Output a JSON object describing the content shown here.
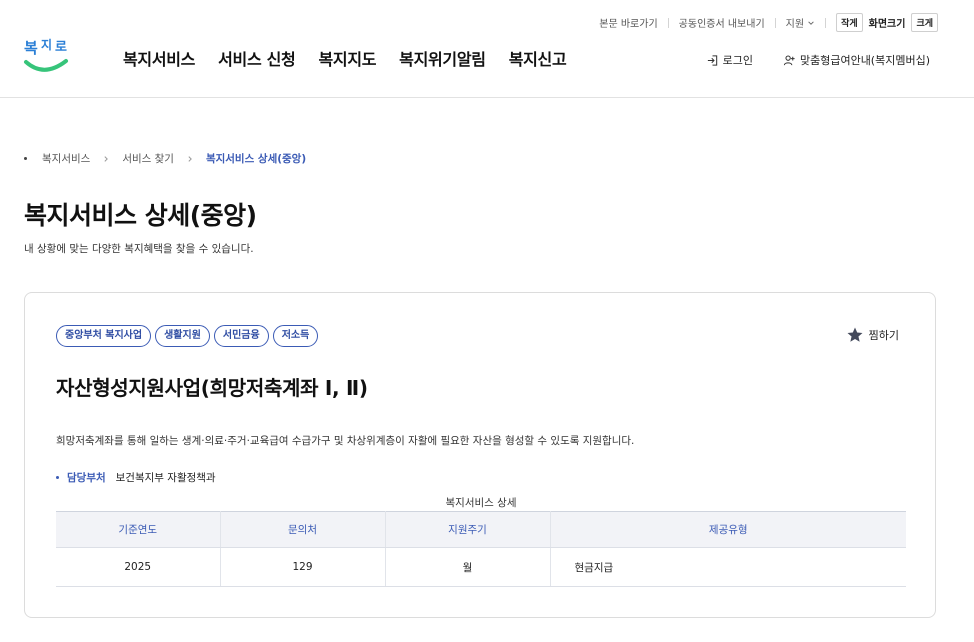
{
  "utility": {
    "skip_to_content": "본문 바로가기",
    "cert_export": "공동인증서 내보내기",
    "region": "지원",
    "small_btn": "작게",
    "font_size_label": "화면크기",
    "large_btn": "크게"
  },
  "logo_text": "복지로",
  "gnb": [
    "복지서비스",
    "서비스 신청",
    "복지지도",
    "복지위기알림",
    "복지신고"
  ],
  "header_right": {
    "login": "로그인",
    "membership": "맞춤형급여안내(복지멤버십)"
  },
  "breadcrumb": {
    "items": [
      "복지서비스",
      "서비스 찾기"
    ],
    "current": "복지서비스 상세(중앙)"
  },
  "page": {
    "title": "복지서비스 상세(중앙)",
    "description": "내 상황에 맞는 다양한 복지혜택을 찾을 수 있습니다."
  },
  "service": {
    "tags": [
      "중앙부처 복지사업",
      "생활지원",
      "서민금융",
      "저소득"
    ],
    "bookmark_label": "찜하기",
    "title": "자산형성지원사업(희망저축계좌 Ⅰ, Ⅱ)",
    "description": "희망저축계좌를 통해 일하는 생계·의료·주거·교육급여 수급가구 및 차상위계층이 자활에 필요한 자산을 형성할 수 있도록 지원합니다.",
    "dept_label": "담당부처",
    "dept_value": "보건복지부 자활정책과",
    "table_caption": "복지서비스 상세",
    "table": {
      "headers": [
        "기준연도",
        "문의처",
        "지원주기",
        "제공유형"
      ],
      "row": [
        "2025",
        "129",
        "월",
        "현금지급"
      ]
    }
  },
  "colors": {
    "accent": "#3b5bb5",
    "logo_blue": "#2b7fd6",
    "logo_green": "#36c47a",
    "star": "#444a5c"
  },
  "icons": {
    "login": "login-icon",
    "membership": "user-plus-icon",
    "bookmark": "star-icon",
    "region_toggle": "chevron-down-icon",
    "breadcrumb_separator": "chevron-right-icon"
  }
}
